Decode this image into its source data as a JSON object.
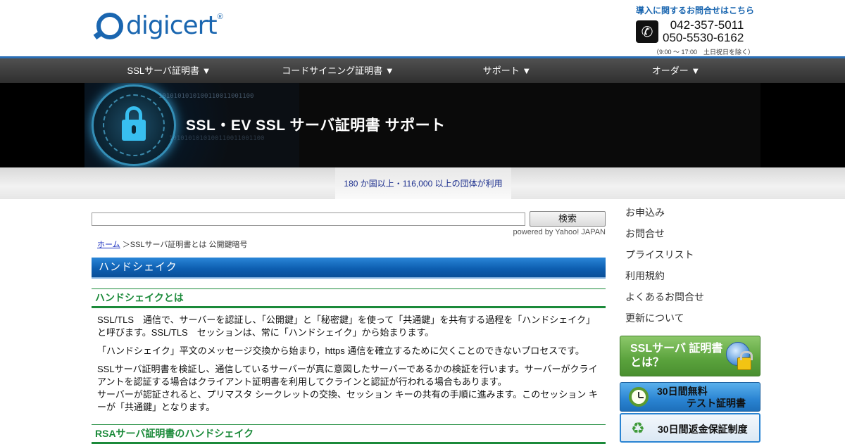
{
  "header": {
    "logo_text": "digicert",
    "logo_reg": "®",
    "contact_caption": "導入に関するお問合せはこちら",
    "phone1": "042-357-5011",
    "phone2": "050-5530-6162",
    "hours": "（9:00 ～ 17:00　土日祝日を除く）"
  },
  "nav": {
    "items": [
      {
        "label": "SSLサーバ証明書 ▼"
      },
      {
        "label": "コードサイニング証明書 ▼"
      },
      {
        "label": "サポート ▼"
      },
      {
        "label": "オーダー ▼"
      }
    ]
  },
  "banner": {
    "title": "SSL・EV SSL サーバ証明書 サポート",
    "binary_text": "1010101010100110011001100"
  },
  "strip": {
    "text": "180 か国以上・116,000 以上の団体が利用"
  },
  "search": {
    "placeholder": "",
    "button_label": "検索",
    "powered": "powered by Yahoo! JAPAN"
  },
  "breadcrumb": {
    "home": "ホーム",
    "rest": " ＞SSLサーバ証明書とは  公開鍵暗号"
  },
  "main": {
    "page_heading": "ハンドシェイク",
    "section1_title": "ハンドシェイクとは",
    "para1": "SSL/TLS　通信で、サーバーを認証し、「公開鍵」と「秘密鍵」を使って「共通鍵」を共有する過程を「ハンドシェイク」と呼びます。SSL/TLS　セッションは、常に「ハンドシェイク」から始まります。",
    "para2": "「ハンドシェイク」平文のメッセージ交換から始まり，https 通信を確立するために欠くことのできないプロセスです。",
    "para3": "SSLサーバ証明書を検証し、通信しているサーバーが真に意図したサーバーであるかの検証を行います。サーバーがクライアントを認証する場合はクライアント証明書を利用してクラインと認証が行われる場合もあります。",
    "para4": "サーバーが認証されると、プリマスタ シークレットの交換、セッション キーの共有の手順に進みます。このセッション キーが「共通鍵」となります。",
    "section2_title": "RSAサーバ証明書のハンドシェイク"
  },
  "sidebar": {
    "links": [
      {
        "label": "お申込み"
      },
      {
        "label": "お問合せ"
      },
      {
        "label": "プライスリスト"
      },
      {
        "label": "利用規約"
      },
      {
        "label": "よくあるお問合せ"
      },
      {
        "label": "更新について"
      }
    ],
    "banner1_line1": "SSLサーバ 証明書",
    "banner1_line2": "とは？",
    "banner2_line1": "30日間無料",
    "banner2_line2": "テスト証明書",
    "banner3": "30日間返金保証制度"
  },
  "colors": {
    "brand_blue": "#1a66b0",
    "heading_green": "#1b8a3a",
    "nav_dark": "#3a3a3a",
    "section_blue": "#0e5fb1"
  }
}
